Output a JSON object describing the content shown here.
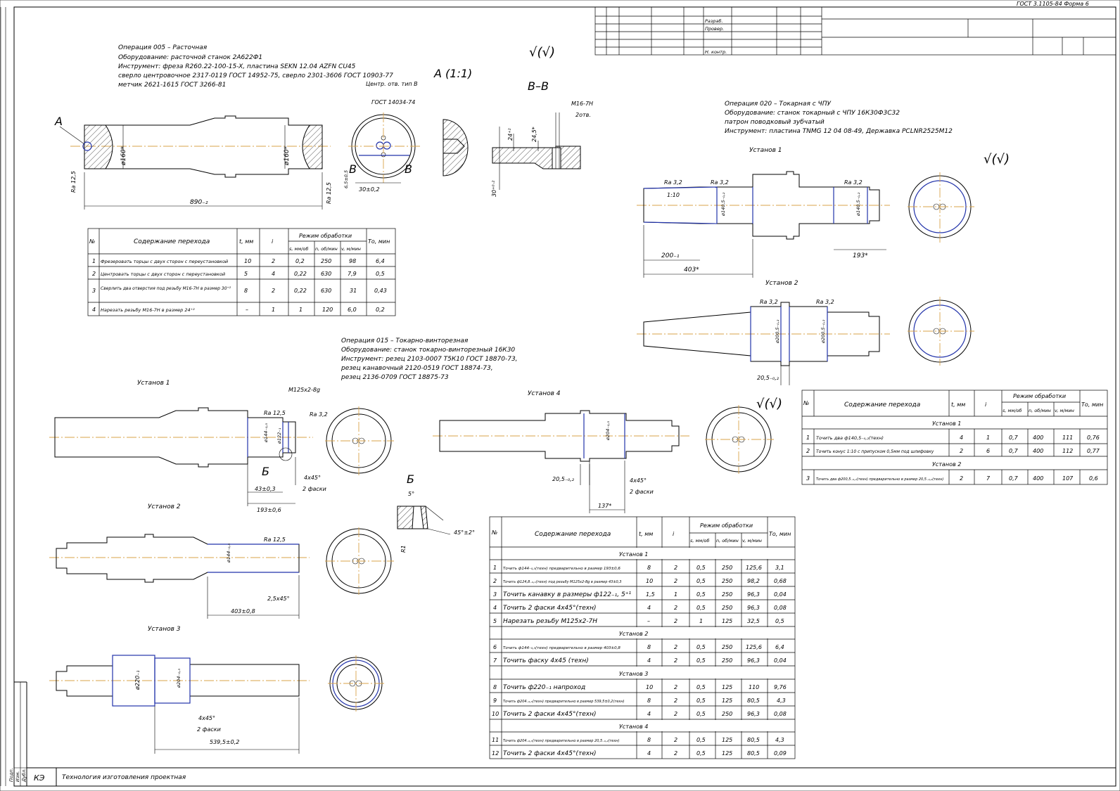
{
  "form_code": "ГОСТ 3.1105-84 Форма 6",
  "title_block": {
    "roles": [
      "Разраб.",
      "Провер.",
      "Н. контр."
    ],
    "kind": "КЭ",
    "name": "Технология изготовления проектная",
    "side_labels": [
      "Подп.",
      "Изм.",
      "Дубл."
    ]
  },
  "op005": {
    "lines": [
      "Операция 005 – Расточная",
      "Оборудование: расточной станок 2А622Ф1",
      "Инструмент: фреза R260.22-100-15-X, пластина SEKN 12.04 AZFN CU45",
      "сверло центровочное 2317-0119 ГОСТ 14952-75, сверло 2301-3606 ГОСТ 10903-77",
      "метчик 2621-1615 ГОСТ 3266-81"
    ],
    "labels": {
      "a": "А",
      "a_scale": "А (1:1)",
      "vv": "В–В",
      "v": "В",
      "dia": "ø160*",
      "len": "890₋₂",
      "ra": "Ra 12,5",
      "center_hole": "Центр. отв. тип В",
      "center_hole_std": "ГОСТ 14034-74",
      "d30": "30±0,2",
      "d65": "6,5±0,5",
      "thread": "M16-7H",
      "two_holes": "2отв.",
      "d24": "24⁺²",
      "d245": "24,5*",
      "d30b": "30⁺⁰·²"
    },
    "table": {
      "headers": [
        "№",
        "Содержание перехода",
        "t, мм",
        "i",
        "Режим обработки",
        "То, мин"
      ],
      "mode_headers": [
        "s, мм/об",
        "n, об/мин",
        "v, м/мин"
      ],
      "rows": [
        [
          "1",
          "Фрезеровать торцы с двух сторон с переустановкой",
          "10",
          "2",
          "0,2",
          "250",
          "98",
          "6,4"
        ],
        [
          "2",
          "Центровать торцы с двух сторон с переустановкой",
          "5",
          "4",
          "0,22",
          "630",
          "7,9",
          "0,5"
        ],
        [
          "3",
          "Сверлить два отверстия под резьбу М16-7Н в размер 30⁺²",
          "8",
          "2",
          "0,22",
          "630",
          "31",
          "0,43"
        ],
        [
          "4",
          "Нарезать резьбу М16-7Н в размер 24⁺²",
          "–",
          "1",
          "1",
          "120",
          "6,0",
          "0,2"
        ]
      ]
    }
  },
  "op015": {
    "lines": [
      "Операция 015 – Токарно-винторезная",
      "Оборудование: станок токарно-винторезный 16К30",
      "Инструмент: резец 2103-0007 Т5К10 ГОСТ 18870-73,",
      "резец канавочный 2120-0519 ГОСТ 18874-73,",
      "резец 2136-0709 ГОСТ 18875-73"
    ],
    "setups": [
      "Установ 1",
      "Установ 2",
      "Установ 3",
      "Установ 4"
    ],
    "labels": {
      "thread": "M125x2-8g",
      "ra125": "Ra 12,5",
      "ra32": "Ra 3,2",
      "d144": "ø144₋₀,₅",
      "d122": "ø122₋₁",
      "b": "Б",
      "ch4": "4x45°",
      "two_ch": "2 фаски",
      "d43": "43±0,3",
      "d193": "193±0,6",
      "d403": "403±0,8",
      "ch25": "2,5x45°",
      "d220": "ø220₋₁",
      "d204": "ø204₋₀,₅",
      "d539": "539,5±0,2",
      "d205": "20,5₋₀,₂",
      "d137": "137*",
      "angle5": "5°",
      "r1": "R1",
      "angle45": "45°±2°"
    },
    "table": {
      "headers": [
        "№",
        "Содержание перехода",
        "t, мм",
        "i",
        "Режим обработки",
        "То, мин"
      ],
      "mode_headers": [
        "s, мм/об",
        "n, об/мин",
        "v, м/мин"
      ],
      "groups": [
        {
          "title": "Установ 1",
          "rows": [
            [
              "1",
              "Точить ф144₋₀,₅(техн) предварительно в размер 193±0,6",
              "8",
              "2",
              "0,5",
              "250",
              "125,6",
              "3,1"
            ],
            [
              "2",
              "Точить ф124,8₋₀,₁(техн) под резьбу М125х2-8g в размер 43±0,3",
              "10",
              "2",
              "0,5",
              "250",
              "98,2",
              "0,68"
            ],
            [
              "3",
              "Точить канавку в размеры ф122₋₁, 5⁺¹",
              "1,5",
              "1",
              "0,5",
              "250",
              "96,3",
              "0,04"
            ],
            [
              "4",
              "Точить 2 фаски 4х45°(техн)",
              "4",
              "2",
              "0,5",
              "250",
              "96,3",
              "0,08"
            ],
            [
              "5",
              "Нарезать резьбу М125х2-7Н",
              "–",
              "2",
              "1",
              "125",
              "32,5",
              "0,5"
            ]
          ]
        },
        {
          "title": "Установ 2",
          "rows": [
            [
              "6",
              "Точить ф144₋₀,₅(техн) предварительно в размер 403±0,8",
              "8",
              "2",
              "0,5",
              "250",
              "125,6",
              "6,4"
            ],
            [
              "7",
              "Точить фаску 4х45 (техн)",
              "4",
              "2",
              "0,5",
              "250",
              "96,3",
              "0,04"
            ]
          ]
        },
        {
          "title": "Установ 3",
          "rows": [
            [
              "8",
              "Точить ф220₋₁ напроход",
              "10",
              "2",
              "0,5",
              "125",
              "110",
              "9,76"
            ],
            [
              "9",
              "Точить ф204₋₀,₅(техн) предварительно в размер 539,5±0,2(техн)",
              "8",
              "2",
              "0,5",
              "125",
              "80,5",
              "4,3"
            ],
            [
              "10",
              "Точить 2 фаски 4х45°(техн)",
              "4",
              "2",
              "0,5",
              "250",
              "96,3",
              "0,08"
            ]
          ]
        },
        {
          "title": "Установ 4",
          "rows": [
            [
              "11",
              "Точить ф204₋₀,₅(техн) предварительно в размер 20,5₋₀,₂(техн)",
              "8",
              "2",
              "0,5",
              "125",
              "80,5",
              "4,3"
            ],
            [
              "12",
              "Точить 2 фаски 4х45°(техн)",
              "4",
              "2",
              "0,5",
              "125",
              "80,5",
              "0,09"
            ]
          ]
        }
      ]
    }
  },
  "op020": {
    "lines": [
      "Операция 020 – Токарная с ЧПУ",
      "Оборудование: станок токарный с ЧПУ 16К30Ф3С32",
      "патрон поводковый зубчатый",
      "Инструмент: пластина TNMG 12 04 08-49, Державка PCLNR2525M12"
    ],
    "setups": [
      "Установ 1",
      "Установ 2"
    ],
    "labels": {
      "ra32": "Ra 3,2",
      "taper": "1:10",
      "d145": "ø140,5₋₀,₂",
      "d200": "200₋₁",
      "d403": "403*",
      "d193": "193*",
      "d2005": "ø200,5₋₀,₂",
      "d205": "20,5₋₀,₂"
    },
    "table": {
      "headers": [
        "№",
        "Содержание перехода",
        "t, мм",
        "i",
        "Режим обработки",
        "То, мин"
      ],
      "mode_headers": [
        "s, мм/об",
        "n, об/мин",
        "v, м/мин"
      ],
      "groups": [
        {
          "title": "Установ 1",
          "rows": [
            [
              "1",
              "Точить два ф140,5₋₀,₂(техн)",
              "4",
              "1",
              "0,7",
              "400",
              "111",
              "0,76"
            ],
            [
              "2",
              "Точить конус 1:10 с припуском 0,5мм под шлифовку",
              "2",
              "6",
              "0,7",
              "400",
              "112",
              "0,77"
            ]
          ]
        },
        {
          "title": "Установ 2",
          "rows": [
            [
              "3",
              "Точить два ф200,5₋₀,₂(техн) предварительно в размер 20,5₋₀,₂(техн)",
              "2",
              "7",
              "0,7",
              "400",
              "107",
              "0,6"
            ]
          ]
        }
      ]
    }
  },
  "roughness_general": "√(√)"
}
